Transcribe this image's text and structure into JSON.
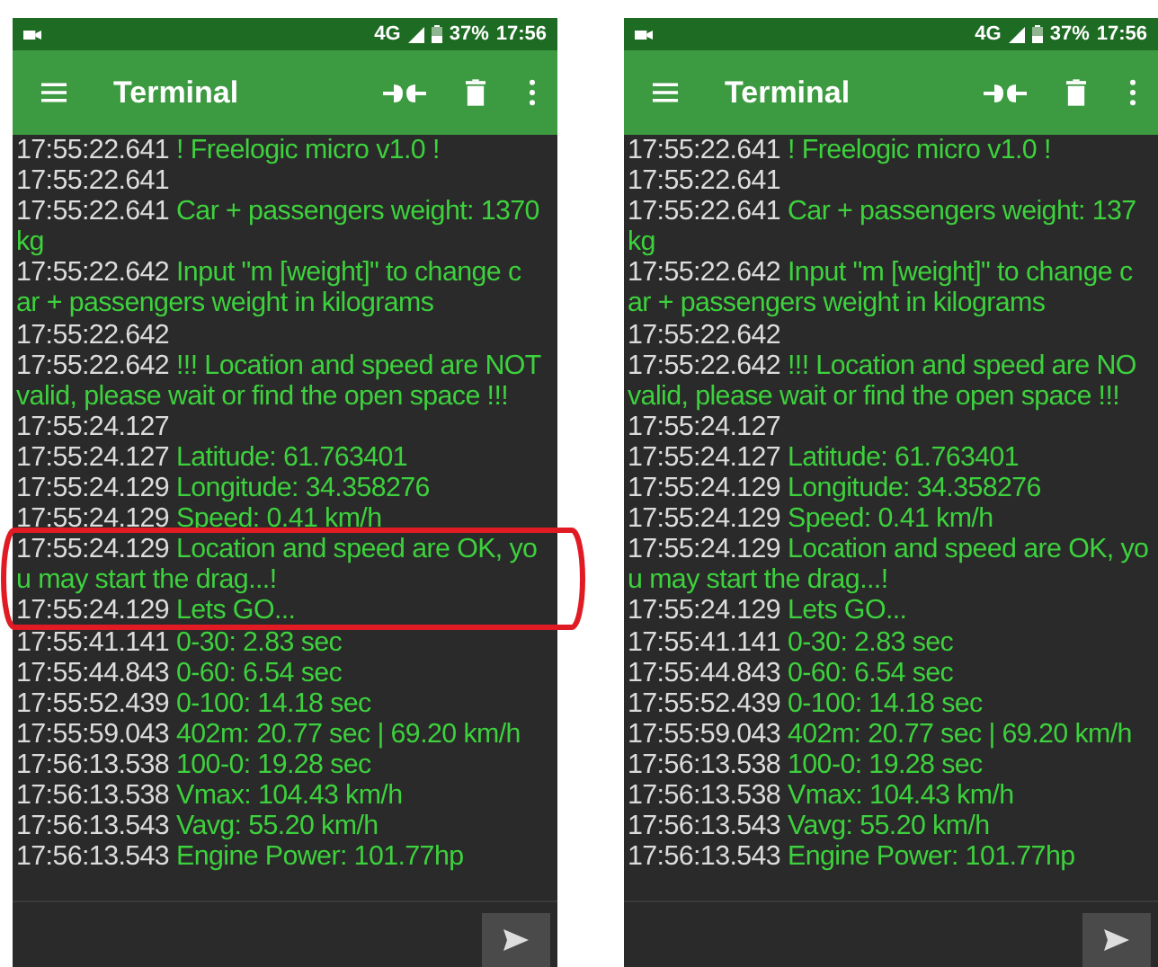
{
  "phones": [
    {
      "status": {
        "network": "4G",
        "battery": "37%",
        "time": "17:56"
      },
      "title": "Terminal",
      "highlight_ellipse": true,
      "log": [
        {
          "time": "17:55:22.641",
          "lines": [
            "! Freelogic micro v1.0 !"
          ]
        },
        {
          "time": "17:55:22.641"
        },
        {
          "time": "17:55:22.641",
          "lines": [
            "Car + passengers weight: 1370",
            "kg"
          ]
        },
        {
          "time": "17:55:22.642",
          "lines": [
            "Input \"m [weight]\" to change c",
            "ar + passengers weight in kilograms"
          ]
        },
        {
          "time": "17:55:22.642"
        },
        {
          "time": "17:55:22.642",
          "lines": [
            "!!! Location and speed are NOT",
            "valid, please wait or find the open space !!!"
          ]
        },
        {
          "time": "17:55:24.127"
        },
        {
          "time": "17:55:24.127",
          "lines": [
            "Latitude: 61.763401"
          ]
        },
        {
          "time": "17:55:24.129",
          "lines": [
            "Longitude: 34.358276"
          ]
        },
        {
          "time": "17:55:24.129",
          "lines": [
            "Speed: 0.41   km/h"
          ]
        },
        {
          "time": "17:55:24.129",
          "lines": [
            "Location and speed are OK, yo",
            "u may start the drag...!"
          ]
        },
        {
          "time": "17:55:24.129",
          "lines": [
            "Lets GO..."
          ]
        },
        {
          "time": "17:55:41.141",
          "lines": [
            "0-30: 2.83  sec"
          ]
        },
        {
          "time": "17:55:44.843",
          "lines": [
            "0-60: 6.54  sec"
          ]
        },
        {
          "time": "17:55:52.439",
          "lines": [
            "0-100: 14.18 sec"
          ]
        },
        {
          "time": "17:55:59.043",
          "lines": [
            "402m: 20.77 sec | 69.20 km/h"
          ]
        },
        {
          "time": "17:56:13.538",
          "lines": [
            "100-0: 19.28 sec"
          ]
        },
        {
          "time": "17:56:13.538",
          "lines": [
            "Vmax: 104.43 km/h"
          ]
        },
        {
          "time": "17:56:13.543",
          "lines": [
            "Vavg: 55.20  km/h"
          ]
        },
        {
          "time": "17:56:13.543",
          "lines": [
            "Engine Power: 101.77hp"
          ]
        }
      ]
    },
    {
      "status": {
        "network": "4G",
        "battery": "37%",
        "time": "17:56"
      },
      "title": "Terminal",
      "highlight_ellipse": false,
      "log": [
        {
          "time": "17:55:22.641",
          "lines": [
            "! Freelogic micro v1.0 !"
          ]
        },
        {
          "time": "17:55:22.641"
        },
        {
          "time": "17:55:22.641",
          "lines": [
            "Car + passengers weight: 137",
            "kg"
          ]
        },
        {
          "time": "17:55:22.642",
          "lines": [
            "Input \"m [weight]\" to change c",
            "ar + passengers weight in kilograms"
          ]
        },
        {
          "time": "17:55:22.642"
        },
        {
          "time": "17:55:22.642",
          "lines": [
            "!!! Location and speed are NO",
            "valid, please wait or find the open space !!!"
          ]
        },
        {
          "time": "17:55:24.127"
        },
        {
          "time": "17:55:24.127",
          "lines": [
            "Latitude: 61.763401"
          ]
        },
        {
          "time": "17:55:24.129",
          "lines": [
            "Longitude: 34.358276"
          ]
        },
        {
          "time": "17:55:24.129",
          "lines": [
            "Speed: 0.41   km/h"
          ]
        },
        {
          "time": "17:55:24.129",
          "lines": [
            "Location and speed are OK, yo",
            "u may start the drag...!"
          ]
        },
        {
          "time": "17:55:24.129",
          "lines": [
            "Lets GO..."
          ]
        },
        {
          "time": "17:55:41.141",
          "lines": [
            "0-30: 2.83  sec"
          ]
        },
        {
          "time": "17:55:44.843",
          "lines": [
            "0-60: 6.54  sec"
          ]
        },
        {
          "time": "17:55:52.439",
          "lines": [
            "0-100: 14.18 sec"
          ]
        },
        {
          "time": "17:55:59.043",
          "lines": [
            "402m: 20.77 sec | 69.20 km/h"
          ]
        },
        {
          "time": "17:56:13.538",
          "lines": [
            "100-0: 19.28 sec"
          ]
        },
        {
          "time": "17:56:13.538",
          "lines": [
            "Vmax: 104.43 km/h"
          ]
        },
        {
          "time": "17:56:13.543",
          "lines": [
            "Vavg: 55.20  km/h"
          ]
        },
        {
          "time": "17:56:13.543",
          "lines": [
            "Engine Power: 101.77hp"
          ]
        }
      ]
    }
  ]
}
